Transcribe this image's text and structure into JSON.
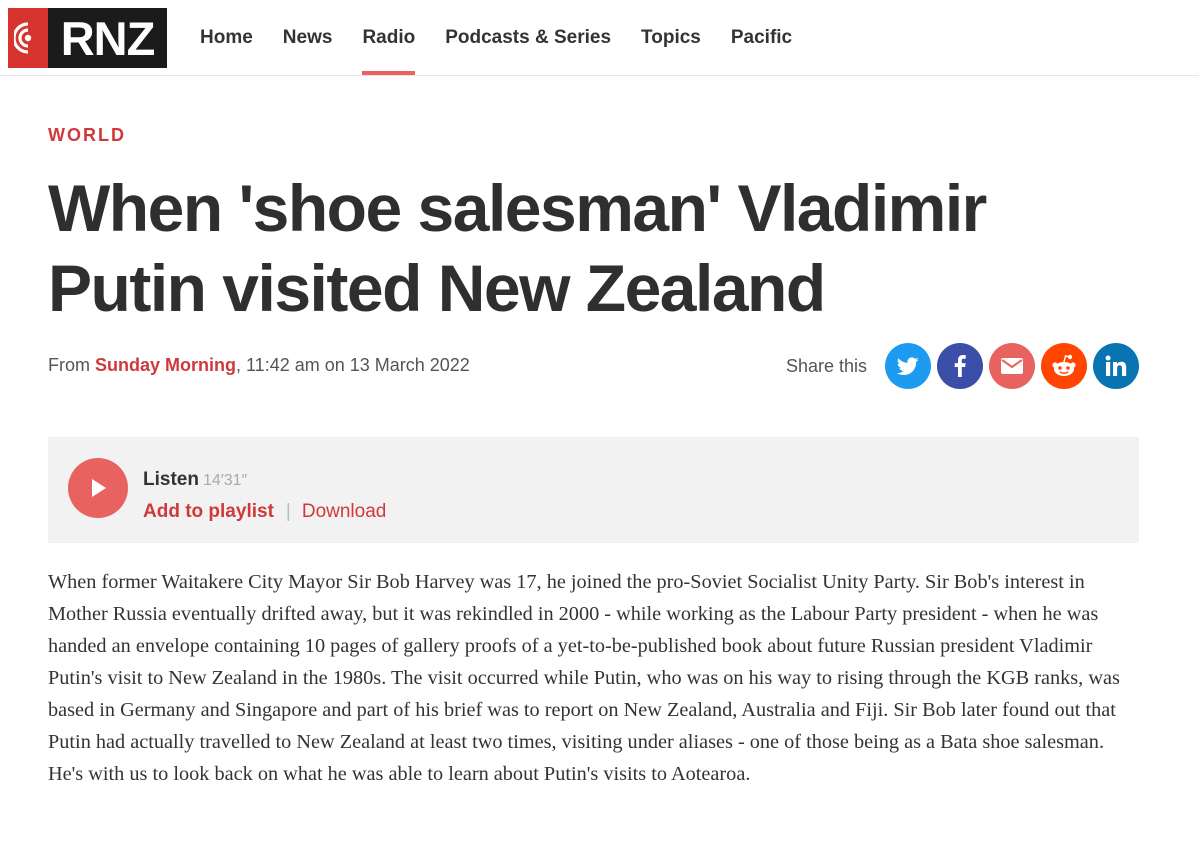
{
  "header": {
    "logo_text": "RNZ",
    "nav": [
      {
        "label": "Home"
      },
      {
        "label": "News"
      },
      {
        "label": "Radio",
        "active": true
      },
      {
        "label": "Podcasts & Series"
      },
      {
        "label": "Topics"
      },
      {
        "label": "Pacific"
      }
    ]
  },
  "article": {
    "section": "WORLD",
    "headline": "When 'shoe salesman' Vladimir Putin visited New Zealand",
    "meta": {
      "from": "From ",
      "programme": "Sunday Morning",
      "datetime": ", 11:42 am on 13 March 2022"
    },
    "share": {
      "label": "Share this",
      "buttons": [
        {
          "name": "twitter",
          "color": "#1d9bf0"
        },
        {
          "name": "facebook",
          "color": "#3b4fa8"
        },
        {
          "name": "email",
          "color": "#e8625f"
        },
        {
          "name": "reddit",
          "color": "#ff4500"
        },
        {
          "name": "linkedin",
          "color": "#0a73b1"
        }
      ]
    },
    "audio": {
      "listen": "Listen",
      "duration": "14′31″",
      "add_to_playlist": "Add to playlist",
      "separator": "|",
      "download": "Download"
    },
    "body": "When former Waitakere City Mayor Sir Bob Harvey was 17, he joined the pro-Soviet Socialist Unity Party. Sir Bob's interest in Mother Russia eventually drifted away, but it was rekindled in 2000 - while working as the Labour Party president - when he was handed an envelope containing 10 pages of gallery proofs of a yet-to-be-published book about future Russian president Vladimir Putin's visit to New Zealand in the 1980s. The visit occurred while Putin, who was on his way to rising through the KGB ranks, was based in Germany and Singapore and part of his brief was to report on New Zealand, Australia and Fiji. Sir Bob later found out that Putin had actually travelled to New Zealand at least two times, visiting under aliases - one of those being as a Bata shoe salesman. He's with us to look back on what he was able to learn about Putin's visits to Aotearoa."
  },
  "colors": {
    "brand_red": "#d8342f",
    "accent_red": "#d0393b",
    "nav_underline": "#e8625f"
  }
}
